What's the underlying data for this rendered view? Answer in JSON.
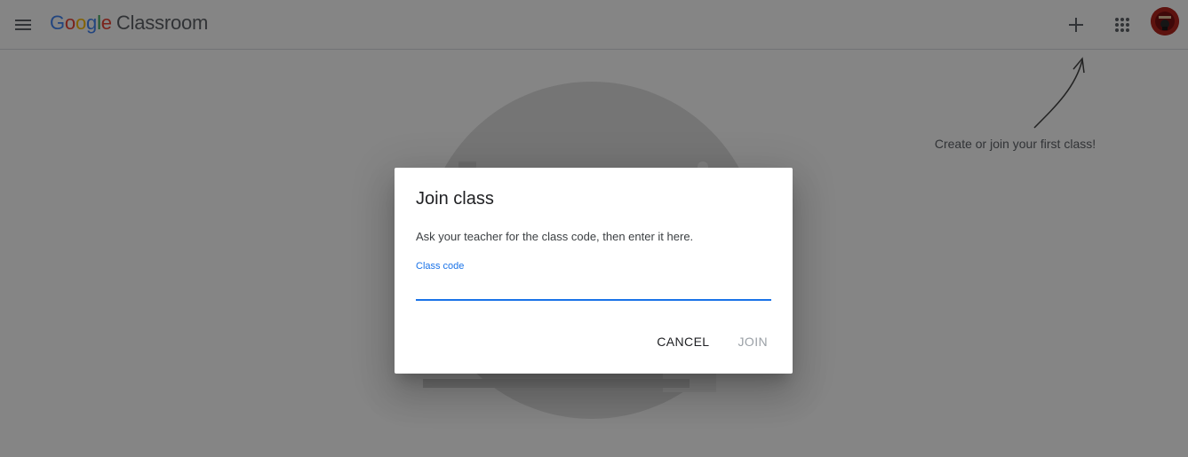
{
  "appbar": {
    "brand_parts": [
      "G",
      "o",
      "o",
      "g",
      "l",
      "e"
    ],
    "product": "Classroom",
    "menu_icon": "hamburger-menu-icon",
    "add_icon": "plus-icon",
    "apps_icon": "apps-grid-icon",
    "account_icon": "account-avatar"
  },
  "empty_state": {
    "hint": "Create or join your first class!"
  },
  "dialog": {
    "title": "Join class",
    "description": "Ask your teacher for the class code, then enter it here.",
    "field_label": "Class code",
    "field_value": "",
    "cancel_label": "CANCEL",
    "join_label": "JOIN"
  },
  "colors": {
    "google_blue": "#4285f4",
    "google_red": "#ea4335",
    "google_yellow": "#fbbc05",
    "google_green": "#34a853",
    "accent": "#1a73e8",
    "disabled": "#9aa0a6"
  }
}
